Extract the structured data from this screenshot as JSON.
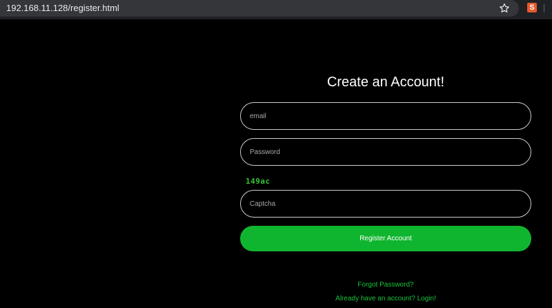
{
  "browser": {
    "url": "192.168.11.128/register.html",
    "extension_glyph": "S"
  },
  "form": {
    "title": "Create an Account!",
    "email_placeholder": "email",
    "password_placeholder": "Password",
    "captcha_code": "149ac",
    "captcha_placeholder": "Captcha",
    "register_label": "Register Account",
    "forgot_label": "Forgot Password?",
    "login_label": "Already have an account? Login!"
  },
  "colors": {
    "accent": "#10b52f",
    "link": "#17c43a",
    "background": "#000000"
  }
}
